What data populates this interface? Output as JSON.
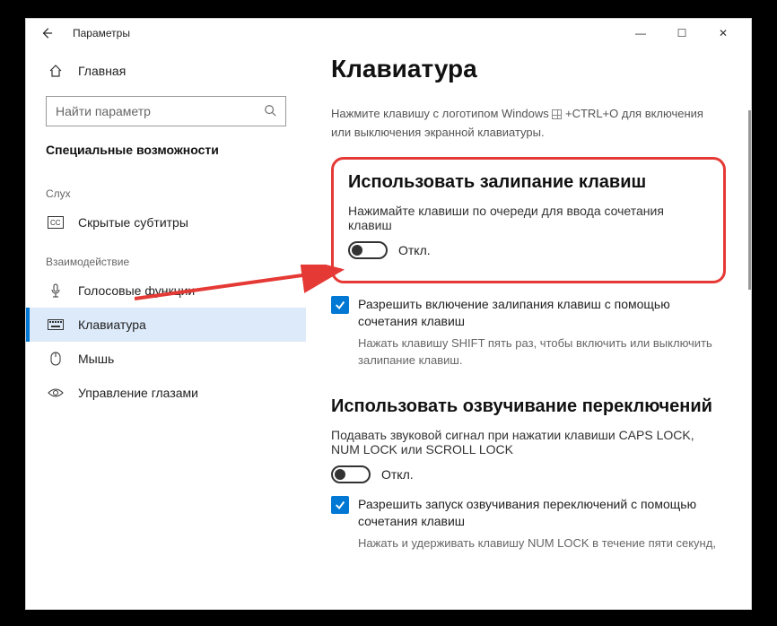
{
  "window": {
    "title": "Параметры",
    "controls": {
      "min": "—",
      "max": "☐",
      "close": "✕"
    }
  },
  "sidebar": {
    "home": "Главная",
    "search_placeholder": "Найти параметр",
    "header": "Специальные возможности",
    "groups": [
      {
        "label": "Слух",
        "items": [
          {
            "key": "captions",
            "label": "Скрытые субтитры",
            "icon": "cc"
          }
        ]
      },
      {
        "label": "Взаимодействие",
        "items": [
          {
            "key": "speech",
            "label": "Голосовые функции",
            "icon": "mic"
          },
          {
            "key": "keyboard",
            "label": "Клавиатура",
            "icon": "kbd",
            "selected": true
          },
          {
            "key": "mouse",
            "label": "Мышь",
            "icon": "mouse"
          },
          {
            "key": "eye",
            "label": "Управление глазами",
            "icon": "eye"
          }
        ]
      }
    ]
  },
  "content": {
    "page_title": "Клавиатура",
    "onscreen_hint_pre": "Нажмите клавишу с логотипом Windows ",
    "onscreen_hint_post": " +CTRL+O для включения или выключения экранной клавиатуры.",
    "sticky": {
      "title": "Использовать залипание клавиш",
      "desc": "Нажимайте клавиши по очереди для ввода сочетания клавиш",
      "toggle_state": "Откл.",
      "allow_shortcut": "Разрешить включение залипания клавиш с помощью сочетания клавиш",
      "allow_sub": "Нажать клавишу SHIFT пять раз, чтобы включить или выключить залипание клавиш."
    },
    "togglekeys": {
      "title": "Использовать озвучивание переключений",
      "desc": "Подавать звуковой сигнал при нажатии клавиши CAPS LOCK, NUM LOCK или SCROLL LOCK",
      "toggle_state": "Откл.",
      "allow_shortcut": "Разрешить запуск озвучивания переключений с помощью сочетания клавиш",
      "allow_sub": "Нажать и удерживать клавишу NUM LOCK в течение пяти секунд,"
    }
  }
}
